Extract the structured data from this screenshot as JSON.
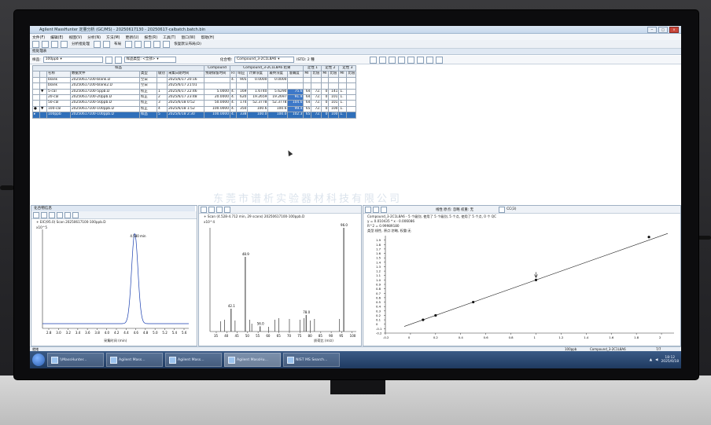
{
  "app": {
    "title": "Agilent MassHunter 定量分析 (GC/MS) - 20250617130 - 20250617-calbatch.batch.bin",
    "menu": [
      "文件(F)",
      "编辑(E)",
      "视图(V)",
      "分析(N)",
      "方法(M)",
      "更新(U)",
      "报告(R)",
      "工具(T)",
      "窗口(W)",
      "帮助(H)"
    ],
    "toolbar": {
      "analyze_label": "分析批处理",
      "layout_label": "布局",
      "restore_label": "恢复默认布局(D)"
    }
  },
  "batch_pane": {
    "header": "批处理表",
    "filter": {
      "sample_label": "样品:",
      "sample_value": "100ppb",
      "type_label": "样品类型: <全部>",
      "compound_label": "化合物:",
      "compound_value": "Compound_3-2C1L8A6",
      "istd_label": "ISTD: 2 種"
    },
    "group_headers": [
      "样品",
      "Compound",
      "Compound_3-2C1L8A6 结果",
      "定性 1",
      "定性 2",
      "定性 3"
    ],
    "columns": [
      "",
      "",
      "名称",
      "数据文件",
      "类型",
      "级别",
      "采集日期时间",
      "预期保留时间",
      "RT",
      "响应",
      "计算浓度",
      "最终浓度",
      "准确度",
      "MI",
      "比值",
      "MI",
      "比值",
      "MI",
      "比值"
    ],
    "rows": [
      {
        "status": "",
        "flag": "",
        "name": "blank",
        "file": "20250617100-blank.D",
        "type": "空白",
        "level": "",
        "date": "2025/6/17 20:16",
        "exp": "",
        "rt": "4.",
        "resp": "905",
        "calc": "0.0000",
        "final": "0.0000",
        "acc": "",
        "q1": "",
        "r1": "",
        "q2": "",
        "r2": "",
        "q3": "",
        "r3": ""
      },
      {
        "status": "",
        "flag": "",
        "name": "blank",
        "file": "20250617100-blank2.D",
        "type": "空白",
        "level": "",
        "date": "2025/6/17 21:01",
        "exp": "",
        "rt": "",
        "resp": "",
        "calc": "",
        "final": "",
        "acc": "",
        "q1": "",
        "r1": "",
        "q2": "",
        "r2": "",
        "q3": "",
        "r3": ""
      },
      {
        "status": "",
        "flag": "▼",
        "name": "5-cal",
        "file": "20250617100-5ppb.D",
        "type": "校正",
        "level": "1",
        "date": "2025/6/17 22:46",
        "exp": "5.0000",
        "rt": "4.",
        "resp": "169",
        "calc": "1.6740",
        "final": "5.6290",
        "acc": "75.6",
        "q1": "64",
        "r1": "72.",
        "q2": "0",
        "r2": "141",
        "q3": "1.",
        "r3": ""
      },
      {
        "status": "",
        "flag": "",
        "name": "20-cal",
        "file": "20250617100-20ppb.D",
        "type": "校正",
        "level": "2",
        "date": "2025/6/17 23:48",
        "exp": "20.0000",
        "rt": "4.",
        "resp": "620",
        "calc": "19.2659",
        "final": "19.2697",
        "acc": "91.9",
        "q1": "64",
        "r1": "72.",
        "q2": "0",
        "r2": "101",
        "q3": "1.",
        "r3": ""
      },
      {
        "status": "",
        "flag": "",
        "name": "50-cal",
        "file": "20250617100-50ppb.D",
        "type": "校正",
        "level": "3",
        "date": "2025/6/18 0:52",
        "exp": "50.0000",
        "rt": "4.",
        "resp": "174",
        "calc": "52.3778",
        "final": "52.3778",
        "acc": "104.6",
        "q1": "64",
        "r1": "72.",
        "q2": "0",
        "r2": "101",
        "q3": "1.",
        "r3": ""
      },
      {
        "status": "●",
        "flag": "▼",
        "name": "100-cal",
        "file": "20250617100-100ppb.D",
        "type": "校正",
        "level": "4",
        "date": "2025/6/18 1:52",
        "exp": "100.0000",
        "rt": "4.",
        "resp": "350",
        "calc": "100.6",
        "final": "100.6",
        "acc": "99.4",
        "q1": "65",
        "r1": "72.",
        "q2": "0",
        "r2": "100",
        "q3": "1.",
        "r3": ""
      },
      {
        "status": "▸",
        "flag": "",
        "name": "100ppb",
        "file": "20250617100-100ppb.D",
        "type": "样品",
        "level": "5",
        "date": "2025/6/18 2:30",
        "exp": "100.0000",
        "rt": "4.",
        "resp": "338",
        "calc": "100.0",
        "final": "100.0",
        "acc": "102.3",
        "q1": "65",
        "r1": "72.",
        "q2": "0",
        "r2": "100",
        "q3": "1.",
        "r3": ""
      }
    ]
  },
  "watermark": "东莞市谱析实验器材科技有限公司",
  "chrom_pane": {
    "header": "化合物信息",
    "trace_label": "+ EIC(95.0) Scan 20250617100-100ppb.D",
    "peak_label": "4.580 min",
    "y_label": "x10^5",
    "x_label": "采集时间 (min)",
    "x_ticks": [
      "2.8",
      "3.0",
      "3.2",
      "3.4",
      "3.6",
      "3.8",
      "4.0",
      "4.2",
      "4.4",
      "4.6",
      "4.8",
      "5.0",
      "5.2",
      "5.4",
      "5.6"
    ]
  },
  "spectrum_pane": {
    "trace_label": "+ Scan (4.528-4.712 min, 29 scans) 20250617100-100ppb.D",
    "y_label": "x10^4",
    "x_label": "质荷比 (m/z)",
    "peaks": [
      {
        "mz": "48.9",
        "label": "48.9"
      },
      {
        "mz": "42.1",
        "label": "42.1"
      },
      {
        "mz": "56.0",
        "label": "56.0"
      },
      {
        "mz": "78.0",
        "label": "78.0"
      },
      {
        "mz": "96.0",
        "label": "96.0"
      }
    ],
    "x_ticks": [
      "35",
      "40",
      "45",
      "50",
      "55",
      "60",
      "65",
      "70",
      "75",
      "80",
      "85",
      "90",
      "95",
      "100"
    ]
  },
  "calib_pane": {
    "toolbar_text": "线性  原点: 忽略  权重: 无",
    "cc_label": "CC(3)",
    "title": "Compound_3-2C1L8A6 - 5 个级别, 使用了 5 个级别, 5 个点, 使用了 5 个点, 0 个 QC",
    "equation": "y = 0.010435 * x - 0.006086",
    "r2": "R^2 = 0.99989180",
    "fit_info": "类型:线性, 原点:忽略, 权重:无",
    "y_label": "相对响应",
    "x_label": "相对浓度",
    "y_ticks": [
      "1.9",
      "1.8",
      "1.7",
      "1.6",
      "1.5",
      "1.4",
      "1.3",
      "1.2",
      "1.1",
      "1.0",
      "0.9",
      "0.8",
      "0.7",
      "0.6",
      "0.5",
      "0.4",
      "0.3",
      "0.2",
      "0.1",
      "0",
      "-0.1",
      "-0.2"
    ],
    "x_ticks": [
      "-0.2",
      "0",
      "0.2",
      "0.4",
      "0.6",
      "0.8",
      "1",
      "1.2",
      "1.4",
      "1.6",
      "1.8",
      "2"
    ],
    "points": [
      {
        "x": 0.1,
        "y": 0.1
      },
      {
        "x": 0.2,
        "y": 0.2
      },
      {
        "x": 0.5,
        "y": 0.5
      },
      {
        "x": 1.0,
        "y": 1.0
      },
      {
        "x": 1.9,
        "y": 1.97
      }
    ]
  },
  "statusbar": {
    "ready": "就绪",
    "sample": "100ppb",
    "compound": "Compound_3-2C1L8A6",
    "count": "7/7"
  },
  "taskbar": {
    "items": [
      "\\\\MassHunter...",
      "Agilent Mass...",
      "Agilent Mass...",
      "Agilent MassHu...",
      "NIST MS Search..."
    ],
    "time": "18:12",
    "date": "2025/6/18"
  }
}
